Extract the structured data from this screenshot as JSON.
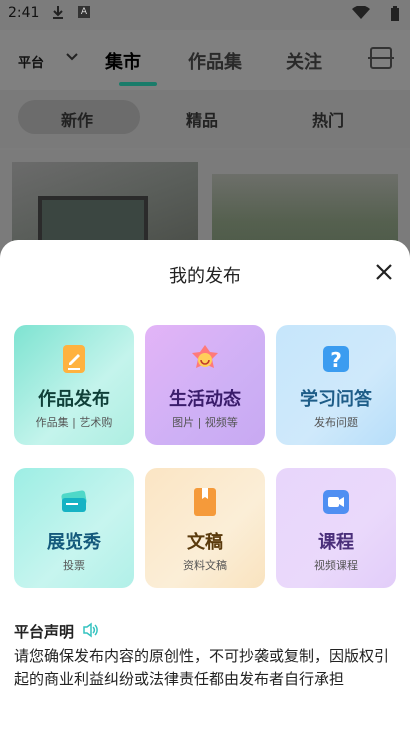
{
  "status": {
    "time": "2:41"
  },
  "nav": {
    "platform": "平台",
    "tabs": [
      "集市",
      "作品集",
      "关注"
    ]
  },
  "subtabs": [
    "新作",
    "精品",
    "热门"
  ],
  "sheet": {
    "title": "我的发布",
    "cards": [
      {
        "title": "作品发布",
        "subtitle": "作品集 | 艺术购",
        "icon": "document-edit-icon"
      },
      {
        "title": "生活动态",
        "subtitle": "图片 | 视频等",
        "icon": "smile-star-icon"
      },
      {
        "title": "学习问答",
        "subtitle": "发布问题",
        "icon": "question-icon"
      },
      {
        "title": "展览秀",
        "subtitle": "投票",
        "icon": "ticket-icon"
      },
      {
        "title": "文稿",
        "subtitle": "资料文稿",
        "icon": "book-bookmark-icon"
      },
      {
        "title": "课程",
        "subtitle": "视频课程",
        "icon": "video-camera-icon"
      }
    ],
    "declaration": {
      "title": "平台声明",
      "body": "请您确保发布内容的原创性，不可抄袭或复制，因版权引起的商业利益纠纷或法律责任都由发布者自行承担"
    }
  },
  "colors": {
    "accent": "#1a7c6a"
  }
}
